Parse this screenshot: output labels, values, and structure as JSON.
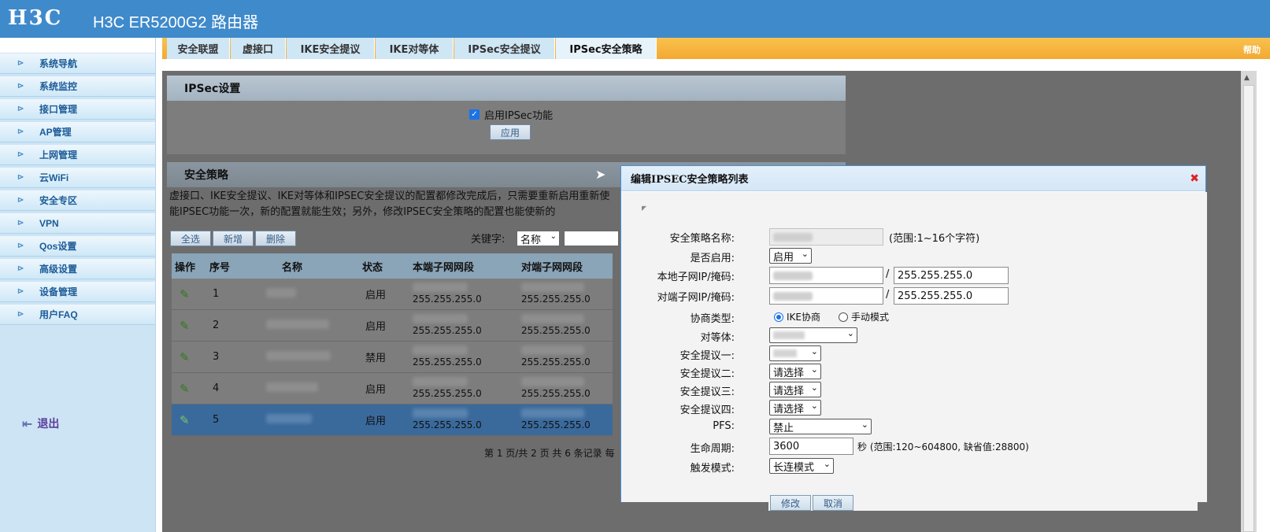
{
  "header": {
    "logo": "H3C",
    "title": "H3C ER5200G2 路由器"
  },
  "sidebar": {
    "items": [
      {
        "label": "系统导航"
      },
      {
        "label": "系统监控"
      },
      {
        "label": "接口管理"
      },
      {
        "label": "AP管理"
      },
      {
        "label": "上网管理"
      },
      {
        "label": "云WiFi"
      },
      {
        "label": "安全专区"
      },
      {
        "label": "VPN"
      },
      {
        "label": "Qos设置"
      },
      {
        "label": "高级设置"
      },
      {
        "label": "设备管理"
      },
      {
        "label": "用户FAQ"
      }
    ],
    "logout": "退出"
  },
  "tabs": [
    {
      "label": "安全联盟"
    },
    {
      "label": "虚接口"
    },
    {
      "label": "IKE安全提议"
    },
    {
      "label": "IKE对等体"
    },
    {
      "label": "IPSec安全提议"
    },
    {
      "label": "IPSec安全策略",
      "active": true
    }
  ],
  "help": "帮助",
  "ipsec_settings": {
    "title": "IPSec设置",
    "enable_label": "启用IPSec功能",
    "enabled": true,
    "apply_button": "应用"
  },
  "policy": {
    "title": "安全策略",
    "description": "虚接口、IKE安全提议、IKE对等体和IPSEC安全提议的配置都修改完成后，只需要重新启用重新使能IPSEC功能一次，新的配置就能生效；另外，修改IPSEC安全策略的配置也能使新的",
    "buttons": {
      "select_all": "全选",
      "add": "新增",
      "delete": "删除"
    },
    "keyword_label": "关键字:",
    "keyword_select": "名称",
    "columns": [
      "操作",
      "序号",
      "名称",
      "状态",
      "本端子网网段",
      "对端子网网段"
    ],
    "rows": [
      {
        "no": "1",
        "state": "启用",
        "local_mask": "255.255.255.0",
        "remote_mask": "255.255.255.0"
      },
      {
        "no": "2",
        "state": "启用",
        "local_mask": "255.255.255.0",
        "remote_mask": "255.255.255.0"
      },
      {
        "no": "3",
        "state": "禁用",
        "local_mask": "255.255.255.0",
        "remote_mask": "255.255.255.0"
      },
      {
        "no": "4",
        "state": "启用",
        "local_mask": "255.255.255.0",
        "remote_mask": "255.255.255.0"
      },
      {
        "no": "5",
        "state": "启用",
        "local_mask": "255.255.255.0",
        "remote_mask": "255.255.255.0"
      }
    ],
    "pager": "第 1 页/共 2 页 共 6 条记录 每"
  },
  "dialog": {
    "title": "编辑IPSEC安全策略列表",
    "fields": {
      "name_label": "安全策略名称:",
      "name_hint": "(范围:1~16个字符)",
      "enable_label": "是否启用:",
      "enable_value": "启用",
      "local_label": "本地子网IP/掩码:",
      "local_mask": "255.255.255.0",
      "remote_label": "对端子网IP/掩码:",
      "remote_mask": "255.255.255.0",
      "nego_label": "协商类型:",
      "nego_ike": "IKE协商",
      "nego_manual": "手动模式",
      "peer_label": "对等体:",
      "prop1_label": "安全提议一:",
      "prop2_label": "安全提议二:",
      "prop2_value": "请选择",
      "prop3_label": "安全提议三:",
      "prop3_value": "请选择",
      "prop4_label": "安全提议四:",
      "prop4_value": "请选择",
      "pfs_label": "PFS:",
      "pfs_value": "禁止",
      "life_label": "生命周期:",
      "life_value": "3600",
      "life_hint": "秒 (范围:120~604800, 缺省值:28800)",
      "trigger_label": "触发模式:",
      "trigger_value": "长连模式"
    },
    "buttons": {
      "modify": "修改",
      "cancel": "取消"
    }
  }
}
